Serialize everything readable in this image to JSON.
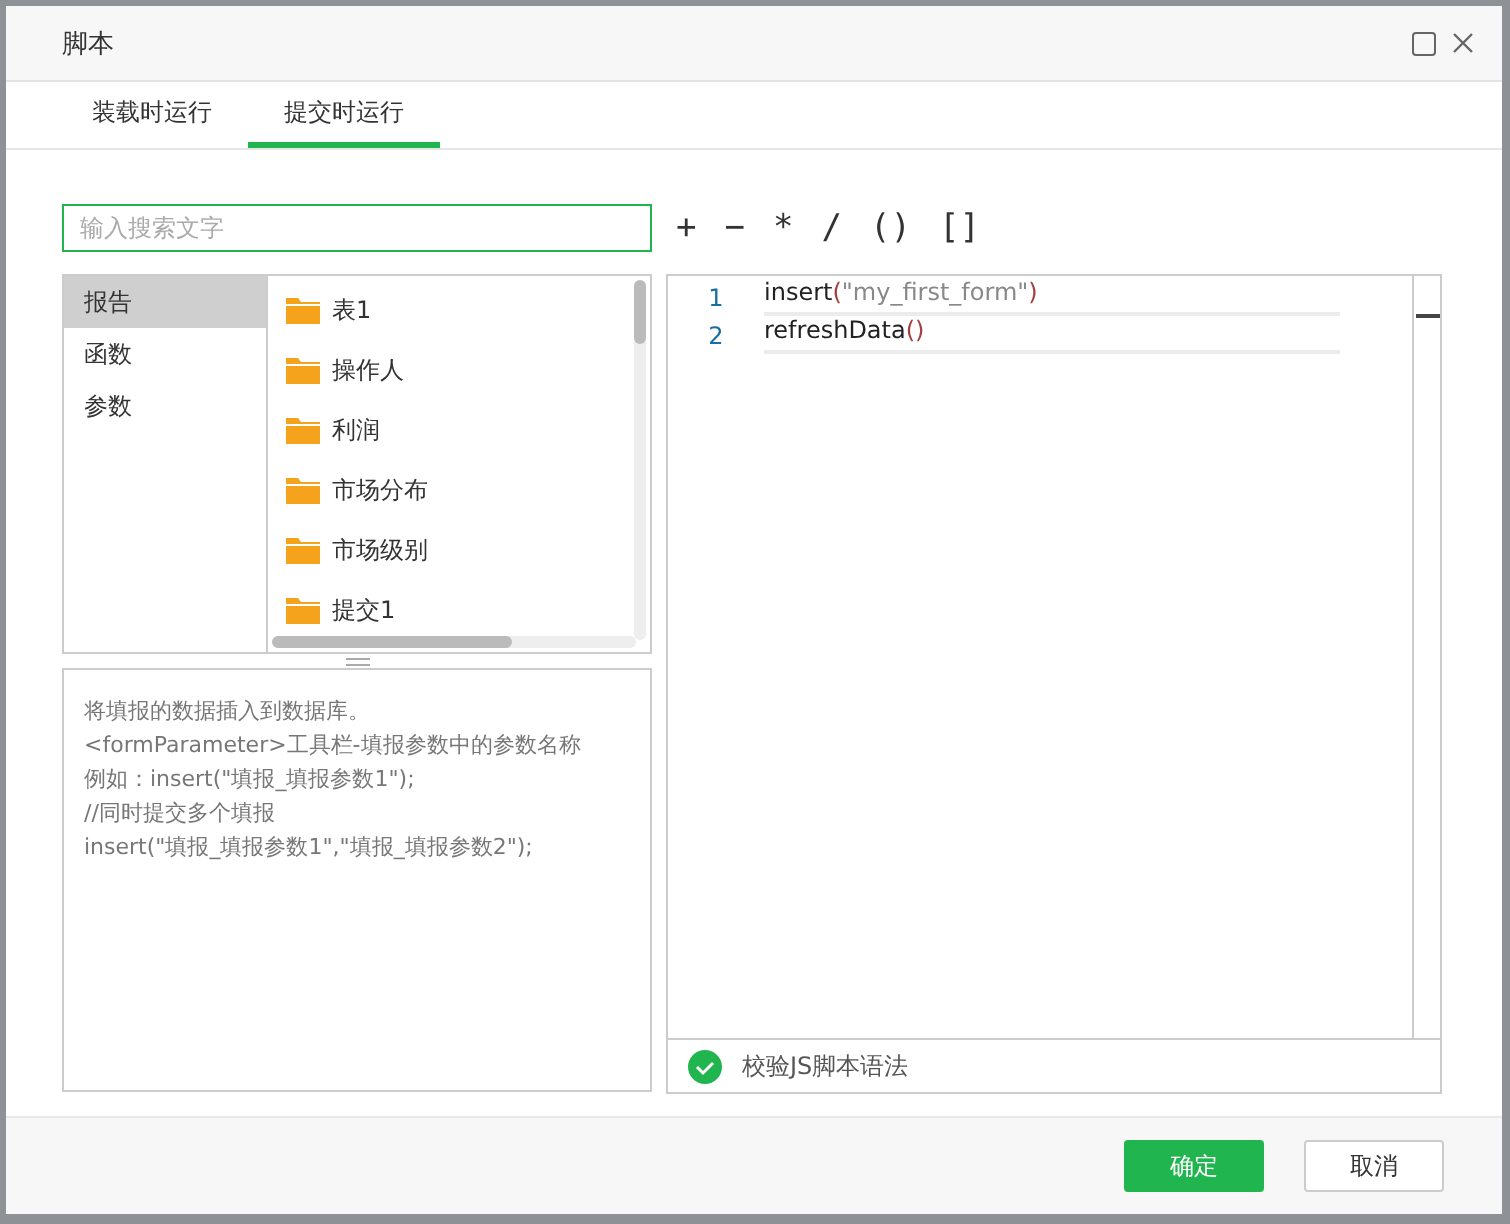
{
  "dialog": {
    "title": "脚本"
  },
  "tabs": [
    {
      "label": "装载时运行",
      "selected": false
    },
    {
      "label": "提交时运行",
      "selected": true
    }
  ],
  "search": {
    "placeholder": "输入搜索文字"
  },
  "operators": [
    "+",
    "−",
    "*",
    "/",
    "()",
    "[]"
  ],
  "categories": [
    {
      "label": "报告",
      "selected": true
    },
    {
      "label": "函数",
      "selected": false
    },
    {
      "label": "参数",
      "selected": false
    }
  ],
  "items": [
    "表1",
    "操作人",
    "利润",
    "市场分布",
    "市场级别",
    "提交1"
  ],
  "description": [
    "将填报的数据插入到数据库。",
    "<formParameter>工具栏-填报参数中的参数名称",
    "例如：insert(\"填报_填报参数1\");",
    "//同时提交多个填报",
    "insert(\"填报_填报参数1\",\"填报_填报参数2\");"
  ],
  "code_lines": [
    {
      "number": "1",
      "tokens": [
        {
          "text": "insert",
          "kind": "name"
        },
        {
          "text": "(",
          "kind": "paren"
        },
        {
          "text": "\"my_first_form\"",
          "kind": "string"
        },
        {
          "text": ")",
          "kind": "paren"
        }
      ]
    },
    {
      "number": "2",
      "tokens": [
        {
          "text": "refreshData",
          "kind": "name"
        },
        {
          "text": "()",
          "kind": "paren"
        }
      ]
    }
  ],
  "validate": {
    "label": "校验JS脚本语法",
    "valid": true
  },
  "buttons": [
    {
      "label": "确定",
      "kind": "primary"
    },
    {
      "label": "取消",
      "kind": "secondary"
    }
  ]
}
